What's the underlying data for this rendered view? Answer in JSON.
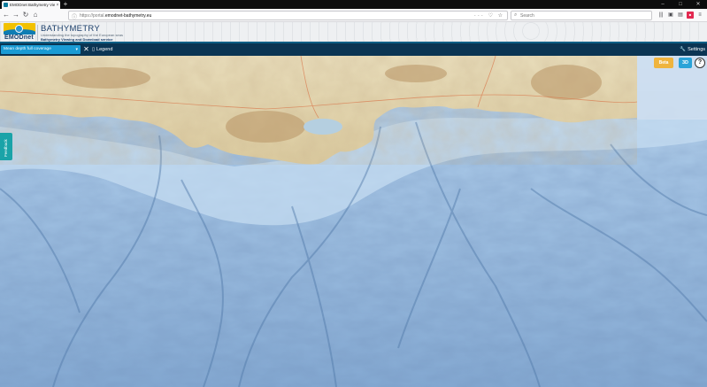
{
  "browser": {
    "tab_title": "EMODnet Bathymetry Viewin...",
    "tab_close": "×",
    "new_tab": "+",
    "url_prefix": "https://portal.",
    "url_domain": "emodnet-bathymetry.eu",
    "url_actions": "··· ♡ ☆",
    "search_placeholder": "Search",
    "window_controls": [
      "–",
      "□",
      "✕"
    ],
    "toolbar_icons": [
      "library-icon",
      "sync-icon",
      "reader-icon",
      "extension-icon",
      "menu-icon"
    ]
  },
  "header": {
    "logo_text": "EMODnet",
    "title": "BATHYMETRY",
    "tagline": "Understanding the topography of the European seas",
    "subtitle": "Bathymetry Viewing and Download service"
  },
  "toolbar": {
    "layer_select_value": "Mean depth full coverage",
    "clear_label": "✕",
    "legend_label": "Legend",
    "settings_label": "Settings"
  },
  "map": {
    "beta_label": "Beta",
    "mode_3d_label": "3D",
    "help_label": "?",
    "feedback_label": "Feedback",
    "colors": {
      "sea_deep": "#6f9cc8",
      "sea_shallow": "#bcd7ee",
      "land": "#e8dcb6",
      "land_relief": "#c9a877",
      "lagoon": "#b7cfdf"
    }
  }
}
